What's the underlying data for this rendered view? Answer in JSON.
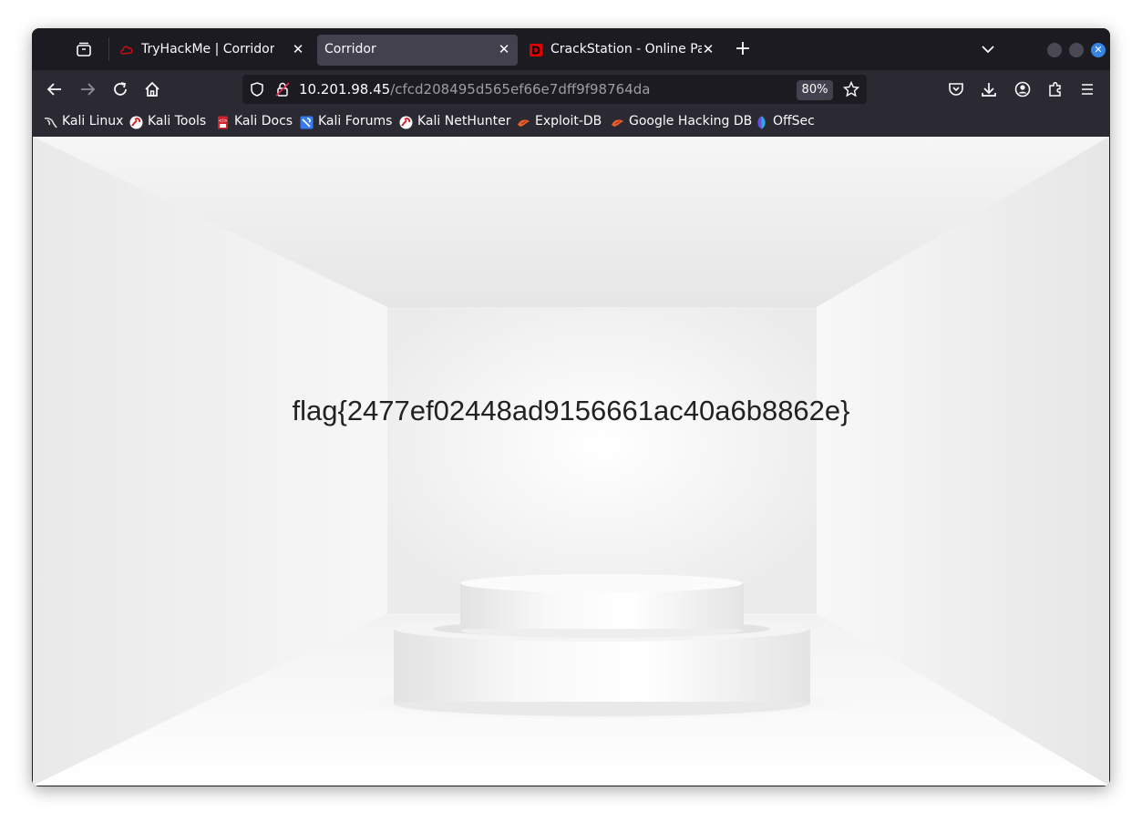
{
  "tabs": [
    {
      "label": "TryHackMe | Corridor",
      "active": false
    },
    {
      "label": "Corridor",
      "active": true
    },
    {
      "label": "CrackStation - Online Pas",
      "active": false
    }
  ],
  "navbar": {
    "url_host": "10.201.98.45",
    "url_path": "/cfcd208495d565ef66e7dff9f98764da",
    "zoom": "80%"
  },
  "bookmarks": [
    {
      "label": "Kali Linux",
      "icon": "kali-dragon-icon"
    },
    {
      "label": "Kali Tools",
      "icon": "kali-tools-icon"
    },
    {
      "label": "Kali Docs",
      "icon": "kali-docs-icon"
    },
    {
      "label": "Kali Forums",
      "icon": "kali-forums-icon"
    },
    {
      "label": "Kali NetHunter",
      "icon": "kali-nethunter-icon"
    },
    {
      "label": "Exploit-DB",
      "icon": "exploit-db-icon"
    },
    {
      "label": "Google Hacking DB",
      "icon": "ghdb-icon"
    },
    {
      "label": "OffSec",
      "icon": "offsec-icon"
    }
  ],
  "page": {
    "flag_text": "flag{2477ef02448ad9156661ac40a6b8862e}"
  },
  "colors": {
    "accent": "#3584e4",
    "tryhackme_red": "#c11111",
    "crackstation_red": "#e00000"
  }
}
